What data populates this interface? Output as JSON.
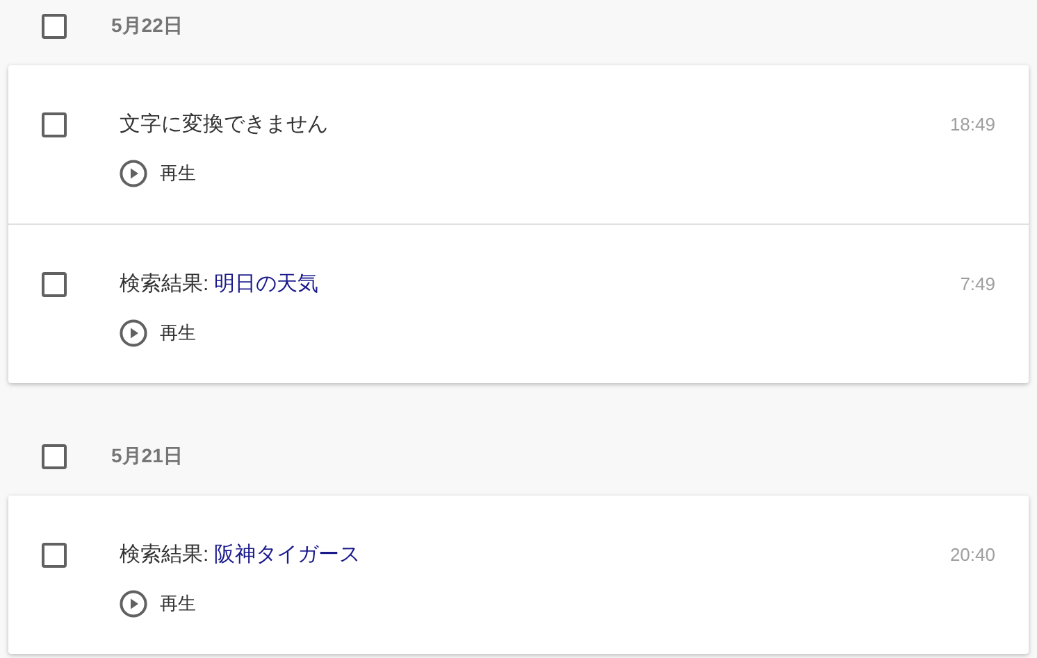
{
  "groups": [
    {
      "date": "5月22日",
      "checked": false,
      "entries": [
        {
          "kind": "text",
          "title": "文字に変換できません",
          "time": "18:49",
          "checked": false,
          "play": "再生"
        },
        {
          "kind": "search",
          "label": "検索結果:",
          "query": "明日の天気",
          "time": "7:49",
          "checked": false,
          "play": "再生"
        }
      ]
    },
    {
      "date": "5月21日",
      "checked": false,
      "entries": [
        {
          "kind": "search",
          "label": "検索結果:",
          "query": "阪神タイガース",
          "time": "20:40",
          "checked": false,
          "play": "再生"
        }
      ]
    }
  ]
}
